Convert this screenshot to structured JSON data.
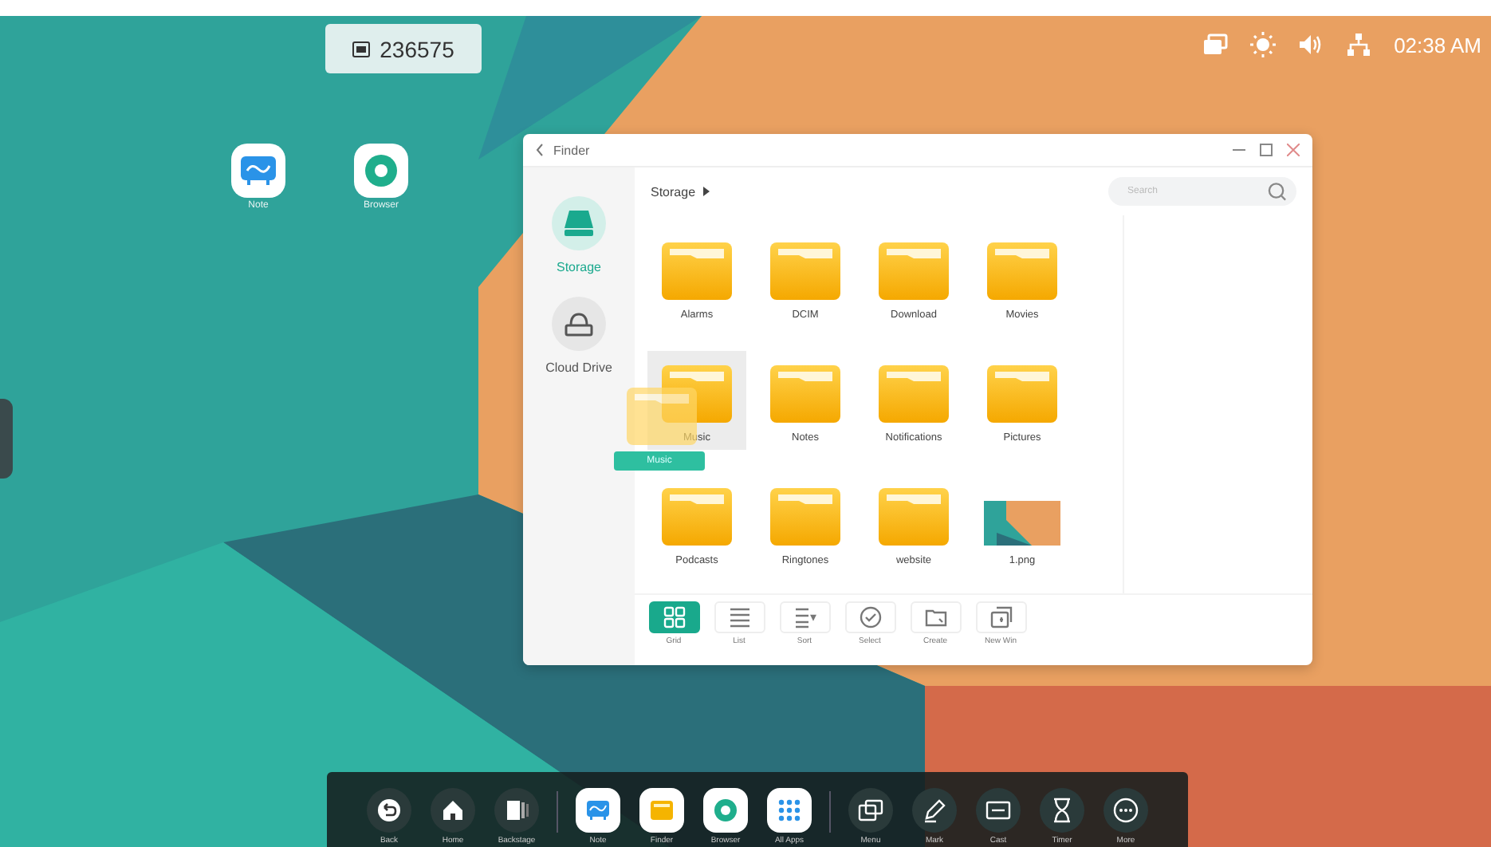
{
  "status_bar": {
    "room_code": "236575",
    "time": "02:38 AM"
  },
  "desktop_icons": [
    {
      "label": "Note"
    },
    {
      "label": "Browser"
    }
  ],
  "finder": {
    "title": "Finder",
    "breadcrumb": "Storage",
    "search": {
      "placeholder": "Search"
    },
    "sidebar": [
      {
        "label": "Storage",
        "selected": true
      },
      {
        "label": "Cloud Drive",
        "selected": false
      }
    ],
    "files": [
      {
        "name": "Alarms",
        "kind": "folder",
        "selected": false
      },
      {
        "name": "DCIM",
        "kind": "folder",
        "selected": false
      },
      {
        "name": "Download",
        "kind": "folder",
        "selected": false
      },
      {
        "name": "Movies",
        "kind": "folder",
        "selected": false
      },
      {
        "name": "Music",
        "kind": "folder",
        "selected": true
      },
      {
        "name": "Notes",
        "kind": "folder",
        "selected": false
      },
      {
        "name": "Notifications",
        "kind": "folder",
        "selected": false
      },
      {
        "name": "Pictures",
        "kind": "folder",
        "selected": false
      },
      {
        "name": "Podcasts",
        "kind": "folder",
        "selected": false
      },
      {
        "name": "Ringtones",
        "kind": "folder",
        "selected": false
      },
      {
        "name": "website",
        "kind": "folder",
        "selected": false
      },
      {
        "name": "1.png",
        "kind": "image",
        "selected": false
      }
    ],
    "drag_label": "Music",
    "toolbar": [
      {
        "label": "Grid",
        "selected": true
      },
      {
        "label": "List",
        "selected": false
      },
      {
        "label": "Sort",
        "selected": false
      },
      {
        "label": "Select",
        "selected": false
      },
      {
        "label": "Create",
        "selected": false
      },
      {
        "label": "New Win",
        "selected": false
      }
    ]
  },
  "dock": [
    {
      "label": "Back",
      "kind": "system"
    },
    {
      "label": "Home",
      "kind": "system"
    },
    {
      "label": "Backstage",
      "kind": "system"
    },
    {
      "label": "Note",
      "kind": "app"
    },
    {
      "label": "Finder",
      "kind": "app"
    },
    {
      "label": "Browser",
      "kind": "app"
    },
    {
      "label": "All Apps",
      "kind": "app"
    },
    {
      "label": "Menu",
      "kind": "system"
    },
    {
      "label": "Mark",
      "kind": "system"
    },
    {
      "label": "Cast",
      "kind": "system"
    },
    {
      "label": "Timer",
      "kind": "system"
    },
    {
      "label": "More",
      "kind": "system"
    }
  ]
}
